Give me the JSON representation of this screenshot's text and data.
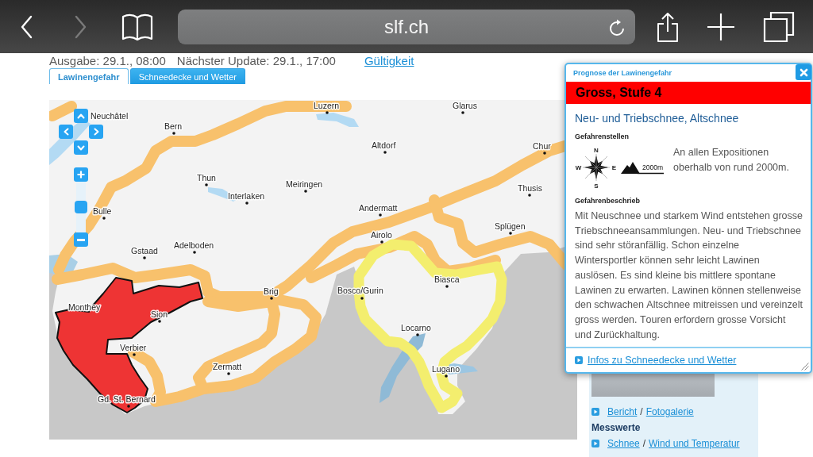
{
  "browser": {
    "nav_buttons": [
      {
        "kind": "back",
        "disabled": false
      },
      {
        "kind": "forward",
        "disabled": true
      }
    ],
    "address": "slf.ch"
  },
  "header": {
    "issued": "Ausgabe: 29.1., 08:00",
    "next_update": "Nächster Update: 29.1., 17:00",
    "validity_link": "Gültigkeit"
  },
  "tabs": [
    {
      "label": "Lawinengefahr",
      "selected": true
    },
    {
      "label": "Schneedecke und Wetter",
      "selected": false
    }
  ],
  "map": {
    "zoom": {
      "level": 0.5
    },
    "danger_areas": [
      {
        "color": "#f8c16c"
      },
      {
        "color": "#ee3434"
      },
      {
        "color": "#f3ee6e"
      }
    ],
    "places": [
      "Luzern",
      "Glarus",
      "Neuchâtel",
      "Bern",
      "Altdorf",
      "Chur",
      "Thun",
      "Meiringen",
      "Thusis",
      "Interlaken",
      "Andermatt",
      "Bulle",
      "Splügen",
      "Airolo",
      "Adelboden",
      "Gstaad",
      "Biasca",
      "Brig",
      "Bosco/Gurin",
      "Monthey",
      "Sion",
      "Locarno",
      "Verbier",
      "Zermatt",
      "Lugano",
      "Gd. St. Bernard"
    ]
  },
  "popup": {
    "title": "Prognose der Lawinengefahr",
    "danger_level": "Gross, Stufe 4",
    "problem": "Neu- und Triebschnee, Altschnee",
    "spots_heading": "Gefahrenstellen",
    "compass": {
      "north": "N",
      "west": "W",
      "east": "E",
      "south": "S"
    },
    "altitude": "2000m",
    "spots_text": "An allen Expositionen oberhalb von rund 2000m.",
    "description_heading": "Gefahrenbeschrieb",
    "description": "Mit Neuschnee und starkem Wind entstehen grosse Triebschneeansammlungen. Neu- und Triebschnee sind sehr störanfällig. Schon einzelne Wintersportler können sehr leicht Lawinen auslösen. Es sind kleine bis mittlere spontane Lawinen zu erwarten. Lawinen können stellenweise den schwachen Altschnee mitreissen und vereinzelt gross werden. Touren erfordern grosse Vorsicht und Zurückhaltung.",
    "link": "Infos zu Schneedecke und Wetter"
  },
  "sidebar": {
    "rows": [
      {
        "kind": "links",
        "links": [
          "Bericht",
          "Fotogalerie"
        ],
        "separator": "/"
      },
      {
        "kind": "heading",
        "text": "Messwerte"
      },
      {
        "kind": "links",
        "links": [
          "Schnee",
          "Wind und Temperatur"
        ],
        "separator": "/"
      }
    ]
  }
}
